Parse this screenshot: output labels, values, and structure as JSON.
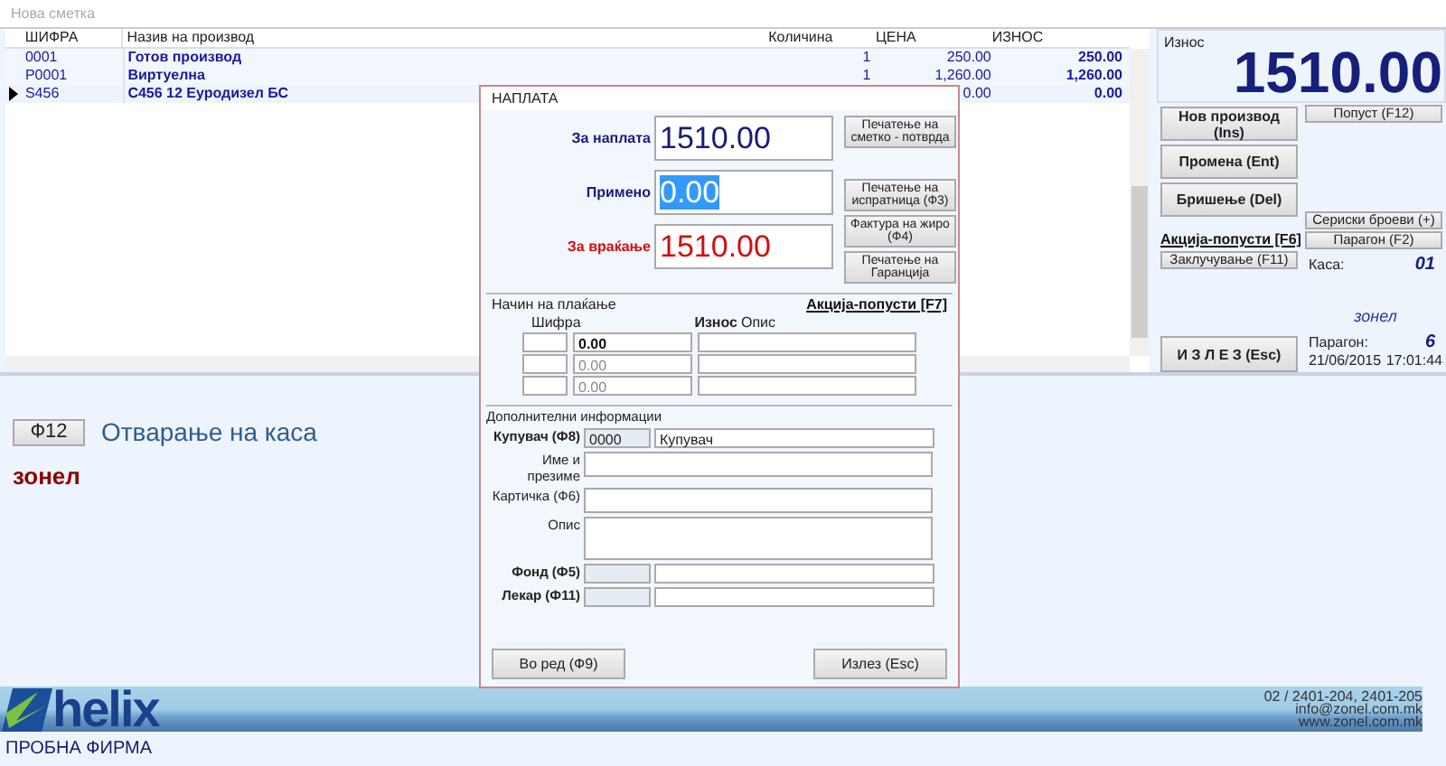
{
  "top_field": {
    "placeholder": "Нова сметка"
  },
  "table": {
    "columns": [
      "ШИФРА",
      "Назив на производ",
      "Количина",
      "ЦЕНА",
      "ИЗНОС"
    ],
    "rows": [
      {
        "code": "0001",
        "name": "Готов производ",
        "qty": "1",
        "price": "250.00",
        "amount": "250.00",
        "selected": false
      },
      {
        "code": "P0001",
        "name": "Виртуелна",
        "qty": "1",
        "price": "1,260.00",
        "amount": "1,260.00",
        "selected": false
      },
      {
        "code": "S456",
        "name": "C456 12 Еуродизел БС",
        "price": "0.00",
        "amount": "0.00",
        "selected": true
      }
    ]
  },
  "summary": {
    "label": "Износ",
    "total": "1510.00"
  },
  "actions": {
    "buttons": [
      "Нов производ (Ins)",
      "Промена (Ent)",
      "Бришење (Del)"
    ],
    "link": "Акција-попусти [F6]",
    "lock": "Заклучување (F11)",
    "exit": "И З Л Е З (Esc)"
  },
  "side": {
    "discount": "Попуст (F12)",
    "buttons": [
      "Сериски броеви (+)",
      "Парагон (F2)"
    ],
    "register_label": "Каса:",
    "register": "01",
    "user": "зонел",
    "receipt_label": "Парагон:",
    "receipt": "6",
    "date": "21/06/2015",
    "time": "17:01:44"
  },
  "open_register": {
    "key": "Ф12",
    "label": "Отварање на каса"
  },
  "user": "зонел",
  "footer": {
    "logo": "helix",
    "company": "ПРОБНА ФИРМА",
    "phone": "02 / 2401-204,  2401-205",
    "email": "info@zonel.com.mk",
    "web": "www.zonel.com.mk"
  },
  "dialog": {
    "title": "НАПЛАТА",
    "amounts": [
      {
        "kind": "due",
        "label": "За наплата",
        "value": "1510.00",
        "text_selected": false
      },
      {
        "kind": "paid",
        "label": "Примено",
        "value": "0.00",
        "text_selected": true
      },
      {
        "kind": "change",
        "label": "За враќање",
        "value": "1510.00",
        "text_selected": false
      }
    ],
    "print_buttons": [
      "Печатење на сметко - потврда",
      "Печатење на испратница (Ф3)",
      "Фактура на жиро (Ф4)",
      "Печатење на Гаранција"
    ],
    "payment": {
      "title": "Начин на плаќање",
      "link": "Акција-попусти [F7]",
      "columns": [
        "Шифра",
        "Износ",
        "Опис"
      ],
      "rows": [
        {
          "amount": "0.00",
          "active": true
        },
        {
          "amount": "0.00",
          "active": false
        },
        {
          "amount": "0.00",
          "active": false
        }
      ]
    },
    "extra": {
      "title": "Дополнителни информации",
      "fields": [
        {
          "kind": "code",
          "label": "Купувач (Ф8)",
          "code": "0000",
          "value": "Купувач",
          "bold": true
        },
        {
          "kind": "text",
          "label": "Име и презиме",
          "bold": false
        },
        {
          "kind": "text",
          "label": "Картичка (Ф6)",
          "bold": false
        },
        {
          "kind": "area",
          "label": "Опис",
          "bold": false
        },
        {
          "kind": "code",
          "label": "Фонд (Ф5)",
          "bold": true
        },
        {
          "kind": "code",
          "label": "Лекар (Ф11)",
          "bold": true
        }
      ]
    },
    "buttons": [
      "Во ред (Ф9)",
      "Излез (Esc)"
    ]
  }
}
